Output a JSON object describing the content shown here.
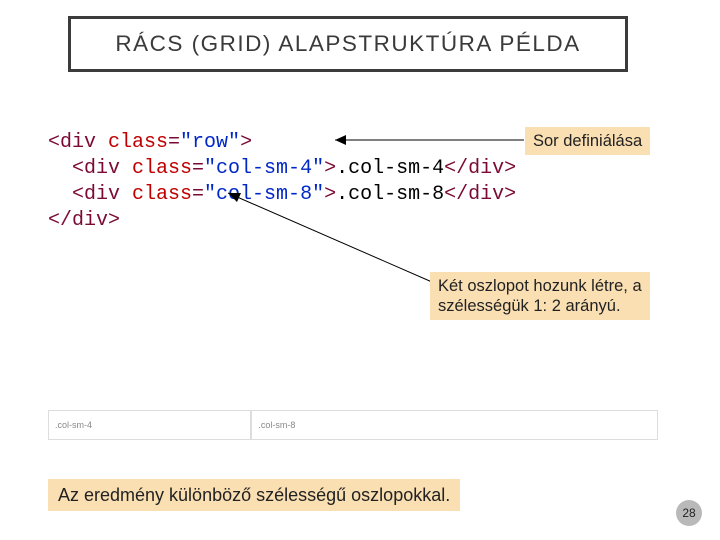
{
  "title": "RÁCS (GRID) ALAPSTRUKTÚRA PÉLDA",
  "code": {
    "l1_a": "<div ",
    "l1_cls": "class",
    "l1_eq": "=",
    "l1_val": "\"row\"",
    "l1_gt": ">",
    "l2_pre": "  <div ",
    "l2_cls": "class",
    "l2_eq": "=",
    "l2_val": "\"col-sm-4\"",
    "l2_gt": ">",
    "l2_txt": ".col-sm-4",
    "l2_end": "</div>",
    "l3_pre": "  <div ",
    "l3_cls": "class",
    "l3_eq": "=",
    "l3_val": "\"col-sm-8\"",
    "l3_gt": ">",
    "l3_txt": ".col-sm-8",
    "l3_end": "</div>",
    "l4": "</div>"
  },
  "callouts": {
    "c1": "Sor definiálása",
    "c2": "Két oszlopot hozunk létre, a szélességük 1: 2 arányú.",
    "c3": "Az eredmény különböző szélességű oszlopokkal."
  },
  "demo": {
    "left": ".col-sm-4",
    "right": ".col-sm-8"
  },
  "page": "28"
}
